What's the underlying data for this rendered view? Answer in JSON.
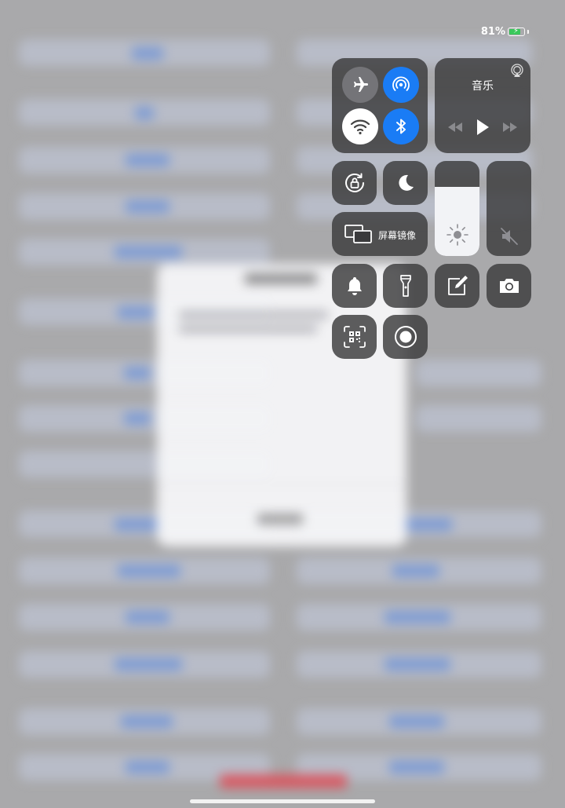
{
  "status_bar": {
    "battery_text": "81%",
    "battery_level": 0.81
  },
  "control_center": {
    "connectivity": {
      "airplane_mode": {
        "icon": "airplane-icon",
        "active": false
      },
      "airdrop": {
        "icon": "airdrop-icon",
        "active": true
      },
      "wifi": {
        "icon": "wifi-icon",
        "active": true
      },
      "bluetooth": {
        "icon": "bluetooth-icon",
        "active": true
      }
    },
    "music": {
      "title": "音乐",
      "controls": [
        "previous-icon",
        "play-icon",
        "next-icon"
      ],
      "airplay_icon": "airplay-icon"
    },
    "orientation_lock": {
      "icon": "rotation-lock-icon"
    },
    "do_not_disturb": {
      "icon": "moon-icon"
    },
    "screen_mirroring": {
      "label": "屏幕镜像",
      "icon": "screen-mirroring-icon"
    },
    "brightness": {
      "level": 0.73,
      "icon": "sun-icon"
    },
    "volume": {
      "level": 0.0,
      "icon": "speaker-muted-icon"
    },
    "shortcuts": [
      "bell-icon",
      "flashlight-icon",
      "notes-icon",
      "camera-icon",
      "qr-scanner-icon",
      "screen-record-icon"
    ]
  },
  "colors": {
    "accent_blue": "#1a7cf5",
    "tile_dark": "#3a3a3c",
    "battery_green": "#3ac85b"
  }
}
